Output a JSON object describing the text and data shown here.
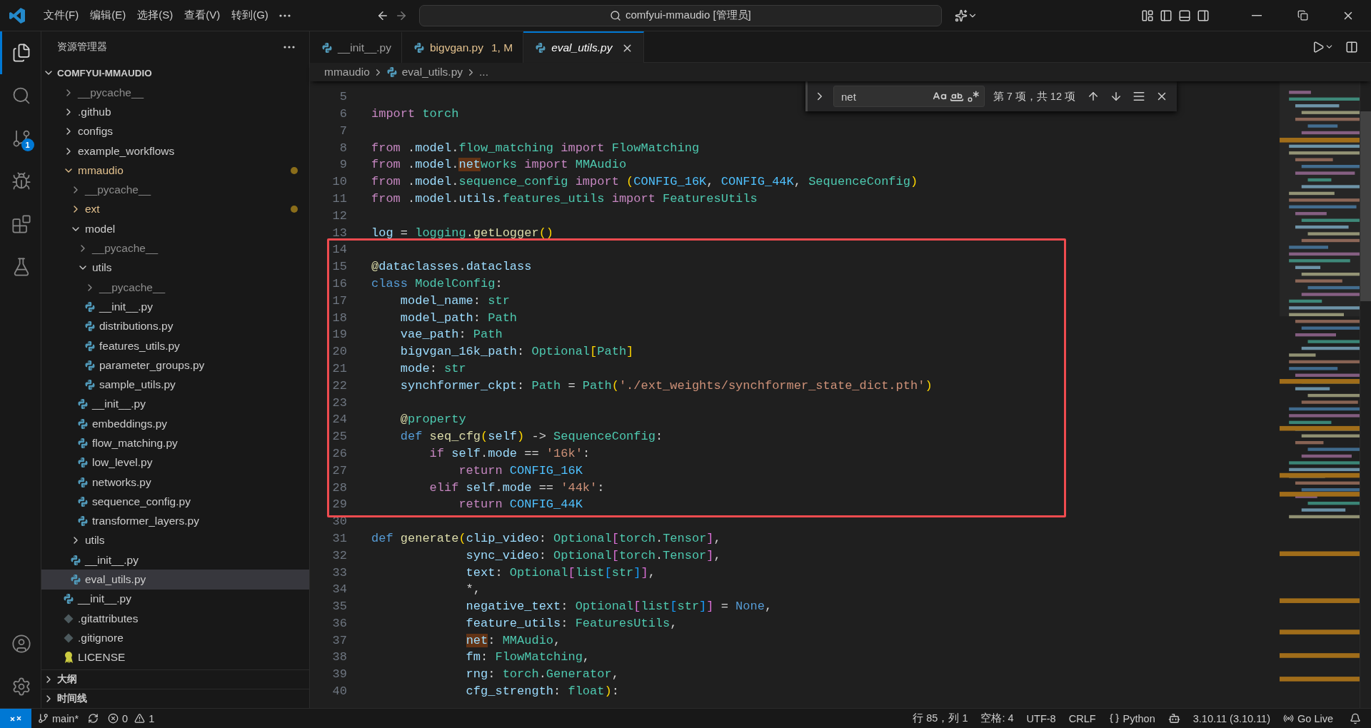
{
  "title_bar": {
    "menus": [
      "文件(F)",
      "编辑(E)",
      "选择(S)",
      "查看(V)",
      "转到(G)"
    ],
    "command_center": "comfyui-mmaudio [管理员]"
  },
  "activity_bar": {
    "items": [
      {
        "kind": "explorer",
        "selected": true
      },
      {
        "kind": "search",
        "selected": false
      },
      {
        "kind": "source_control",
        "selected": false,
        "badge": "1"
      },
      {
        "kind": "run",
        "selected": false
      },
      {
        "kind": "extensions",
        "selected": false
      },
      {
        "kind": "testing",
        "selected": false
      }
    ]
  },
  "sidebar": {
    "title": "资源管理器",
    "folder": "COMFYUI-MMAUDIO",
    "tree": [
      {
        "label": "__pycache__",
        "kind": "folder",
        "expanded": false,
        "modified": false,
        "ignored": true,
        "selected": false
      },
      {
        "label": ".github",
        "kind": "folder",
        "expanded": false,
        "modified": false,
        "ignored": false,
        "selected": false
      },
      {
        "label": "configs",
        "kind": "folder",
        "expanded": false,
        "modified": false,
        "ignored": false,
        "selected": false
      },
      {
        "label": "example_workflows",
        "kind": "folder",
        "expanded": false,
        "modified": false,
        "ignored": false,
        "selected": false
      },
      {
        "label": "mmaudio",
        "kind": "folder",
        "expanded": true,
        "modified": true,
        "ignored": false,
        "selected": false,
        "children": [
          {
            "label": "__pycache__",
            "kind": "folder",
            "expanded": false,
            "modified": false,
            "ignored": true,
            "selected": false
          },
          {
            "label": "ext",
            "kind": "folder",
            "expanded": false,
            "modified": true,
            "ignored": false,
            "selected": false
          },
          {
            "label": "model",
            "kind": "folder",
            "expanded": true,
            "modified": false,
            "ignored": false,
            "selected": false,
            "children": [
              {
                "label": "__pycache__",
                "kind": "folder",
                "expanded": false,
                "modified": false,
                "ignored": true,
                "selected": false
              },
              {
                "label": "utils",
                "kind": "folder",
                "expanded": true,
                "modified": false,
                "ignored": false,
                "selected": false,
                "children": [
                  {
                    "label": "__pycache__",
                    "kind": "folder",
                    "expanded": false,
                    "modified": false,
                    "ignored": true,
                    "selected": false
                  },
                  {
                    "label": "__init__.py",
                    "kind": "python",
                    "modified": false,
                    "ignored": false,
                    "selected": false
                  },
                  {
                    "label": "distributions.py",
                    "kind": "python",
                    "modified": false,
                    "ignored": false,
                    "selected": false
                  },
                  {
                    "label": "features_utils.py",
                    "kind": "python",
                    "modified": false,
                    "ignored": false,
                    "selected": false
                  },
                  {
                    "label": "parameter_groups.py",
                    "kind": "python",
                    "modified": false,
                    "ignored": false,
                    "selected": false
                  },
                  {
                    "label": "sample_utils.py",
                    "kind": "python",
                    "modified": false,
                    "ignored": false,
                    "selected": false
                  }
                ]
              },
              {
                "label": "__init__.py",
                "kind": "python",
                "modified": false,
                "ignored": false,
                "selected": false
              },
              {
                "label": "embeddings.py",
                "kind": "python",
                "modified": false,
                "ignored": false,
                "selected": false
              },
              {
                "label": "flow_matching.py",
                "kind": "python",
                "modified": false,
                "ignored": false,
                "selected": false
              },
              {
                "label": "low_level.py",
                "kind": "python",
                "modified": false,
                "ignored": false,
                "selected": false
              },
              {
                "label": "networks.py",
                "kind": "python",
                "modified": false,
                "ignored": false,
                "selected": false
              },
              {
                "label": "sequence_config.py",
                "kind": "python",
                "modified": false,
                "ignored": false,
                "selected": false
              },
              {
                "label": "transformer_layers.py",
                "kind": "python",
                "modified": false,
                "ignored": false,
                "selected": false
              }
            ]
          },
          {
            "label": "utils",
            "kind": "folder",
            "expanded": false,
            "modified": false,
            "ignored": false,
            "selected": false
          },
          {
            "label": "__init__.py",
            "kind": "python",
            "modified": false,
            "ignored": false,
            "selected": false
          },
          {
            "label": "eval_utils.py",
            "kind": "python",
            "modified": false,
            "ignored": false,
            "selected": true
          }
        ]
      },
      {
        "label": "__init__.py",
        "kind": "python",
        "modified": false,
        "ignored": false,
        "selected": false
      },
      {
        "label": ".gitattributes",
        "kind": "git",
        "modified": false,
        "ignored": false,
        "selected": false
      },
      {
        "label": ".gitignore",
        "kind": "git",
        "modified": false,
        "ignored": false,
        "selected": false
      },
      {
        "label": "LICENSE",
        "kind": "license",
        "modified": false,
        "ignored": false,
        "selected": false
      }
    ],
    "sections": [
      {
        "label": "大纲",
        "expanded": false
      },
      {
        "label": "时间线",
        "expanded": false
      }
    ]
  },
  "tabs": [
    {
      "label": "__init__.py",
      "selected": false,
      "modified": false,
      "preview": false
    },
    {
      "label": "bigvgan.py",
      "note": "1, M",
      "selected": false,
      "modified": true,
      "preview": false
    },
    {
      "label": "eval_utils.py",
      "selected": true,
      "modified": false,
      "preview": true
    }
  ],
  "breadcrumbs": [
    {
      "label": "mmaudio",
      "kind": "folder"
    },
    {
      "label": "eval_utils.py",
      "kind": "python"
    },
    {
      "label": "...",
      "kind": "symbol"
    }
  ],
  "find": {
    "value": "net",
    "result": "第 7 项，共 12 项"
  },
  "code": {
    "lines": [
      {
        "number": "5",
        "boxed": false
      },
      {
        "number": "6",
        "boxed": false,
        "tokens": [
          {
            "text": "import",
            "kind": "keyword"
          },
          {
            "text": " torch",
            "kind": "type"
          }
        ]
      },
      {
        "number": "7",
        "boxed": false
      },
      {
        "number": "8",
        "boxed": false,
        "tokens": [
          {
            "text": "from",
            "kind": "keyword"
          },
          {
            "text": " .",
            "kind": "plain"
          },
          {
            "text": "model",
            "kind": "variable"
          },
          {
            "text": ".",
            "kind": "plain"
          },
          {
            "text": "flow_matching",
            "kind": "type"
          },
          {
            "text": " import",
            "kind": "keyword"
          },
          {
            "text": " FlowMatching",
            "kind": "type"
          }
        ]
      },
      {
        "number": "9",
        "boxed": false,
        "tokens": [
          {
            "text": "from",
            "kind": "keyword"
          },
          {
            "text": " .",
            "kind": "plain"
          },
          {
            "text": "model",
            "kind": "variable"
          },
          {
            "text": ".",
            "kind": "plain"
          },
          {
            "text": "net",
            "kind": "match"
          },
          {
            "text": "works",
            "kind": "type"
          },
          {
            "text": " import",
            "kind": "keyword"
          },
          {
            "text": " MMAudio",
            "kind": "type"
          }
        ]
      },
      {
        "number": "10",
        "boxed": false,
        "tokens": [
          {
            "text": "from",
            "kind": "keyword"
          },
          {
            "text": " .",
            "kind": "plain"
          },
          {
            "text": "model",
            "kind": "variable"
          },
          {
            "text": ".",
            "kind": "plain"
          },
          {
            "text": "sequence_config",
            "kind": "type"
          },
          {
            "text": " import",
            "kind": "keyword"
          },
          {
            "text": " (",
            "kind": "bracket1"
          },
          {
            "text": "CONFIG_16K",
            "kind": "constant"
          },
          {
            "text": ",",
            "kind": "plain"
          },
          {
            "text": " CONFIG_44K",
            "kind": "constant"
          },
          {
            "text": ",",
            "kind": "plain"
          },
          {
            "text": " SequenceConfig",
            "kind": "type"
          },
          {
            "text": ")",
            "kind": "bracket1"
          }
        ]
      },
      {
        "number": "11",
        "boxed": false,
        "tokens": [
          {
            "text": "from",
            "kind": "keyword"
          },
          {
            "text": " .",
            "kind": "plain"
          },
          {
            "text": "model",
            "kind": "variable"
          },
          {
            "text": ".",
            "kind": "plain"
          },
          {
            "text": "utils",
            "kind": "variable"
          },
          {
            "text": ".",
            "kind": "plain"
          },
          {
            "text": "features_utils",
            "kind": "type"
          },
          {
            "text": " import",
            "kind": "keyword"
          },
          {
            "text": " FeaturesUtils",
            "kind": "type"
          }
        ]
      },
      {
        "number": "12",
        "boxed": false
      },
      {
        "number": "13",
        "boxed": false,
        "tokens": [
          {
            "text": "log",
            "kind": "variable"
          },
          {
            "text": " =",
            "kind": "plain"
          },
          {
            "text": " logging",
            "kind": "type"
          },
          {
            "text": ".",
            "kind": "plain"
          },
          {
            "text": "getLogger",
            "kind": "function"
          },
          {
            "text": "()",
            "kind": "bracket1"
          }
        ]
      },
      {
        "number": "14",
        "boxed": true
      },
      {
        "number": "15",
        "boxed": true,
        "tokens": [
          {
            "text": "@",
            "kind": "function"
          },
          {
            "text": "dataclasses",
            "kind": "variable"
          },
          {
            "text": ".",
            "kind": "plain"
          },
          {
            "text": "dataclass",
            "kind": "variable"
          }
        ]
      },
      {
        "number": "16",
        "boxed": true,
        "tokens": [
          {
            "text": "class",
            "kind": "storage"
          },
          {
            "text": " ModelConfig",
            "kind": "type"
          },
          {
            "text": ":",
            "kind": "plain"
          }
        ]
      },
      {
        "number": "17",
        "boxed": true,
        "tokens": [
          {
            "text": "    model_name",
            "kind": "variable"
          },
          {
            "text": ":",
            "kind": "plain"
          },
          {
            "text": " str",
            "kind": "type"
          }
        ]
      },
      {
        "number": "18",
        "boxed": true,
        "tokens": [
          {
            "text": "    model_path",
            "kind": "variable"
          },
          {
            "text": ":",
            "kind": "plain"
          },
          {
            "text": " Path",
            "kind": "type"
          }
        ]
      },
      {
        "number": "19",
        "boxed": true,
        "tokens": [
          {
            "text": "    vae_path",
            "kind": "variable"
          },
          {
            "text": ":",
            "kind": "plain"
          },
          {
            "text": " Path",
            "kind": "type"
          }
        ]
      },
      {
        "number": "20",
        "boxed": true,
        "tokens": [
          {
            "text": "    bigvgan_16k_path",
            "kind": "variable"
          },
          {
            "text": ":",
            "kind": "plain"
          },
          {
            "text": " Optional",
            "kind": "type"
          },
          {
            "text": "[",
            "kind": "bracket1"
          },
          {
            "text": "Path",
            "kind": "type"
          },
          {
            "text": "]",
            "kind": "bracket1"
          }
        ]
      },
      {
        "number": "21",
        "boxed": true,
        "tokens": [
          {
            "text": "    mode",
            "kind": "variable"
          },
          {
            "text": ":",
            "kind": "plain"
          },
          {
            "text": " str",
            "kind": "type"
          }
        ]
      },
      {
        "number": "22",
        "boxed": true,
        "tokens": [
          {
            "text": "    synchformer_ckpt",
            "kind": "variable"
          },
          {
            "text": ":",
            "kind": "plain"
          },
          {
            "text": " Path",
            "kind": "type"
          },
          {
            "text": " =",
            "kind": "plain"
          },
          {
            "text": " Path",
            "kind": "type"
          },
          {
            "text": "(",
            "kind": "bracket1"
          },
          {
            "text": "'./ext_weights/synchformer_state_dict.pth'",
            "kind": "string"
          },
          {
            "text": ")",
            "kind": "bracket1"
          }
        ]
      },
      {
        "number": "23",
        "boxed": true
      },
      {
        "number": "24",
        "boxed": true,
        "tokens": [
          {
            "text": "    @",
            "kind": "function"
          },
          {
            "text": "property",
            "kind": "type"
          }
        ]
      },
      {
        "number": "25",
        "boxed": true,
        "tokens": [
          {
            "text": "    def",
            "kind": "storage"
          },
          {
            "text": " seq_cfg",
            "kind": "function"
          },
          {
            "text": "(",
            "kind": "bracket1"
          },
          {
            "text": "self",
            "kind": "variable"
          },
          {
            "text": ")",
            "kind": "bracket1"
          },
          {
            "text": " ->",
            "kind": "plain"
          },
          {
            "text": " SequenceConfig",
            "kind": "type"
          },
          {
            "text": ":",
            "kind": "plain"
          }
        ]
      },
      {
        "number": "26",
        "boxed": true,
        "tokens": [
          {
            "text": "        if",
            "kind": "keyword"
          },
          {
            "text": " self",
            "kind": "variable"
          },
          {
            "text": ".",
            "kind": "plain"
          },
          {
            "text": "mode",
            "kind": "variable"
          },
          {
            "text": " ==",
            "kind": "plain"
          },
          {
            "text": " '16k'",
            "kind": "string"
          },
          {
            "text": ":",
            "kind": "plain"
          }
        ]
      },
      {
        "number": "27",
        "boxed": true,
        "tokens": [
          {
            "text": "            return",
            "kind": "keyword"
          },
          {
            "text": " CONFIG_16K",
            "kind": "constant"
          }
        ]
      },
      {
        "number": "28",
        "boxed": true,
        "tokens": [
          {
            "text": "        elif",
            "kind": "keyword"
          },
          {
            "text": " self",
            "kind": "variable"
          },
          {
            "text": ".",
            "kind": "plain"
          },
          {
            "text": "mode",
            "kind": "variable"
          },
          {
            "text": " ==",
            "kind": "plain"
          },
          {
            "text": " '44k'",
            "kind": "string"
          },
          {
            "text": ":",
            "kind": "plain"
          }
        ]
      },
      {
        "number": "29",
        "boxed": true,
        "tokens": [
          {
            "text": "            return",
            "kind": "keyword"
          },
          {
            "text": " CONFIG_44K",
            "kind": "constant"
          }
        ]
      },
      {
        "number": "30",
        "boxed": false
      },
      {
        "number": "31",
        "boxed": false,
        "tokens": [
          {
            "text": "def",
            "kind": "storage"
          },
          {
            "text": " generate",
            "kind": "function"
          },
          {
            "text": "(",
            "kind": "bracket1"
          },
          {
            "text": "clip_video",
            "kind": "variable"
          },
          {
            "text": ":",
            "kind": "plain"
          },
          {
            "text": " Optional",
            "kind": "type"
          },
          {
            "text": "[",
            "kind": "bracket2"
          },
          {
            "text": "torch",
            "kind": "type"
          },
          {
            "text": ".",
            "kind": "plain"
          },
          {
            "text": "Tensor",
            "kind": "type"
          },
          {
            "text": "]",
            "kind": "bracket2"
          },
          {
            "text": ",",
            "kind": "plain"
          }
        ]
      },
      {
        "number": "32",
        "boxed": false,
        "tokens": [
          {
            "text": "             sync_video",
            "kind": "variable"
          },
          {
            "text": ":",
            "kind": "plain"
          },
          {
            "text": " Optional",
            "kind": "type"
          },
          {
            "text": "[",
            "kind": "bracket2"
          },
          {
            "text": "torch",
            "kind": "type"
          },
          {
            "text": ".",
            "kind": "plain"
          },
          {
            "text": "Tensor",
            "kind": "type"
          },
          {
            "text": "]",
            "kind": "bracket2"
          },
          {
            "text": ",",
            "kind": "plain"
          }
        ]
      },
      {
        "number": "33",
        "boxed": false,
        "tokens": [
          {
            "text": "             text",
            "kind": "variable"
          },
          {
            "text": ":",
            "kind": "plain"
          },
          {
            "text": " Optional",
            "kind": "type"
          },
          {
            "text": "[",
            "kind": "bracket2"
          },
          {
            "text": "list",
            "kind": "type"
          },
          {
            "text": "[",
            "kind": "bracket3"
          },
          {
            "text": "str",
            "kind": "type"
          },
          {
            "text": "]",
            "kind": "bracket3"
          },
          {
            "text": "]",
            "kind": "bracket2"
          },
          {
            "text": ",",
            "kind": "plain"
          }
        ]
      },
      {
        "number": "34",
        "boxed": false,
        "tokens": [
          {
            "text": "             *,",
            "kind": "plain"
          }
        ]
      },
      {
        "number": "35",
        "boxed": false,
        "tokens": [
          {
            "text": "             negative_text",
            "kind": "variable"
          },
          {
            "text": ":",
            "kind": "plain"
          },
          {
            "text": " Optional",
            "kind": "type"
          },
          {
            "text": "[",
            "kind": "bracket2"
          },
          {
            "text": "list",
            "kind": "type"
          },
          {
            "text": "[",
            "kind": "bracket3"
          },
          {
            "text": "str",
            "kind": "type"
          },
          {
            "text": "]",
            "kind": "bracket3"
          },
          {
            "text": "]",
            "kind": "bracket2"
          },
          {
            "text": " =",
            "kind": "plain"
          },
          {
            "text": " None",
            "kind": "storage"
          },
          {
            "text": ",",
            "kind": "plain"
          }
        ]
      },
      {
        "number": "36",
        "boxed": false,
        "tokens": [
          {
            "text": "             feature_utils",
            "kind": "variable"
          },
          {
            "text": ":",
            "kind": "plain"
          },
          {
            "text": " FeaturesUtils",
            "kind": "type"
          },
          {
            "text": ",",
            "kind": "plain"
          }
        ]
      },
      {
        "number": "37",
        "boxed": false,
        "tokens": [
          {
            "text": "             net",
            "kind": "match"
          },
          {
            "text": ":",
            "kind": "plain"
          },
          {
            "text": " MMAudio",
            "kind": "type"
          },
          {
            "text": ",",
            "kind": "plain"
          }
        ]
      },
      {
        "number": "38",
        "boxed": false,
        "tokens": [
          {
            "text": "             fm",
            "kind": "variable"
          },
          {
            "text": ":",
            "kind": "plain"
          },
          {
            "text": " FlowMatching",
            "kind": "type"
          },
          {
            "text": ",",
            "kind": "plain"
          }
        ]
      },
      {
        "number": "39",
        "boxed": false,
        "tokens": [
          {
            "text": "             rng",
            "kind": "variable"
          },
          {
            "text": ":",
            "kind": "plain"
          },
          {
            "text": " torch",
            "kind": "type"
          },
          {
            "text": ".",
            "kind": "plain"
          },
          {
            "text": "Generator",
            "kind": "type"
          },
          {
            "text": ",",
            "kind": "plain"
          }
        ]
      },
      {
        "number": "40",
        "boxed": false,
        "tokens": [
          {
            "text": "             cfg_strength",
            "kind": "variable"
          },
          {
            "text": ":",
            "kind": "plain"
          },
          {
            "text": " float",
            "kind": "type"
          },
          {
            "text": ")",
            "kind": "bracket1"
          },
          {
            "text": ":",
            "kind": "plain"
          }
        ]
      }
    ]
  },
  "status_bar": {
    "branch": "main*",
    "errors": "0",
    "warnings": "1",
    "position": "行 85，列 1",
    "indent": "空格: 4",
    "encoding": "UTF-8",
    "eol": "CRLF",
    "language": "Python",
    "interpreter": "3.10.11 (3.10.11)",
    "live": "Go Live"
  }
}
